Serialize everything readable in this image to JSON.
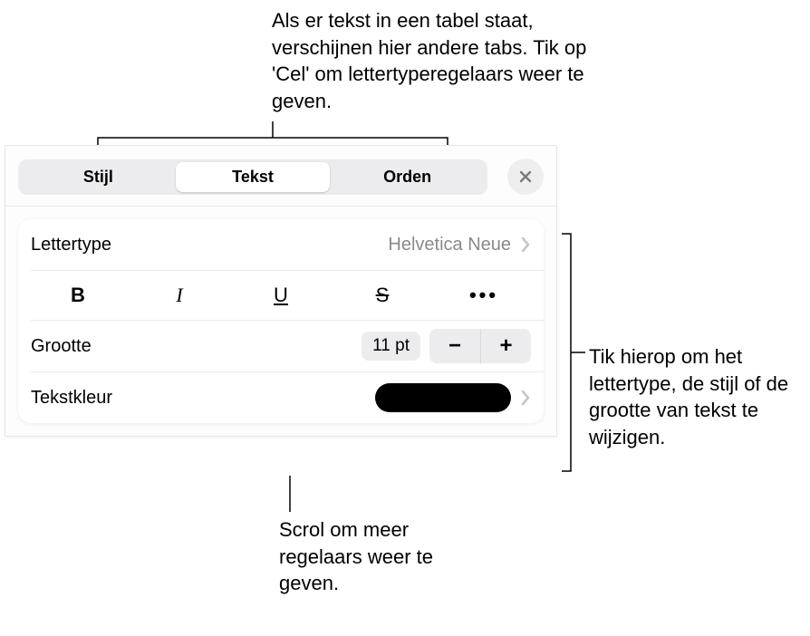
{
  "callouts": {
    "top": "Als er tekst in een tabel staat, verschijnen hier andere tabs. Tik op 'Cel' om lettertyperegelaars weer te geven.",
    "right": "Tik hierop om het lettertype, de stijl of de grootte van tekst te wijzigen.",
    "bottom": "Scrol om meer regelaars weer te geven."
  },
  "panel": {
    "tabs": {
      "stijl": "Stijl",
      "tekst": "Tekst",
      "orden": "Orden"
    },
    "font_row_label": "Lettertype",
    "font_row_value": "Helvetica Neue",
    "fmt": {
      "bold": "B",
      "italic": "I",
      "underline": "U",
      "strike": "S",
      "more": "•••"
    },
    "size_label": "Grootte",
    "size_value": "11 pt",
    "stepper": {
      "minus": "−",
      "plus": "+"
    },
    "color_label": "Tekstkleur",
    "color_value_hex": "#000000"
  }
}
